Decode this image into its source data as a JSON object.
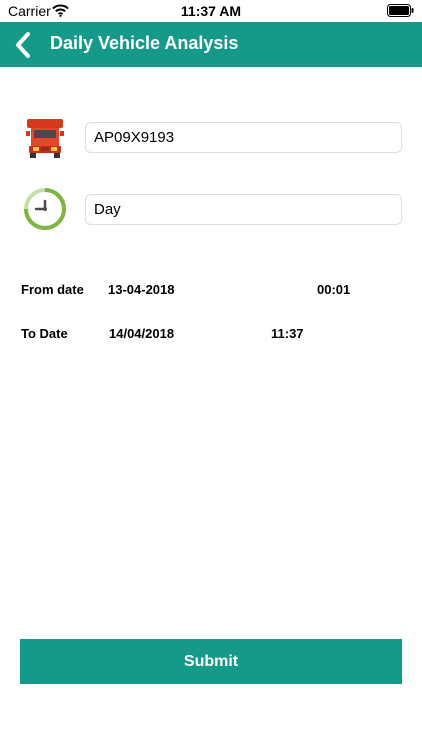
{
  "status_bar": {
    "carrier": "Carrier",
    "time": "11:37 AM"
  },
  "header": {
    "title": "Daily Vehicle Analysis"
  },
  "form": {
    "vehicle_number": "AP09X9193",
    "period": "Day",
    "from_label": "From date",
    "from_date": "13-04-2018",
    "from_time": "00:01",
    "to_label": "To Date",
    "to_date": "14/04/2018",
    "to_time": "11:37",
    "submit_label": "Submit"
  },
  "colors": {
    "accent": "#159a8a"
  },
  "icons": {
    "vehicle": "truck-icon",
    "period": "clock-icon",
    "back": "chevron-left-icon"
  }
}
